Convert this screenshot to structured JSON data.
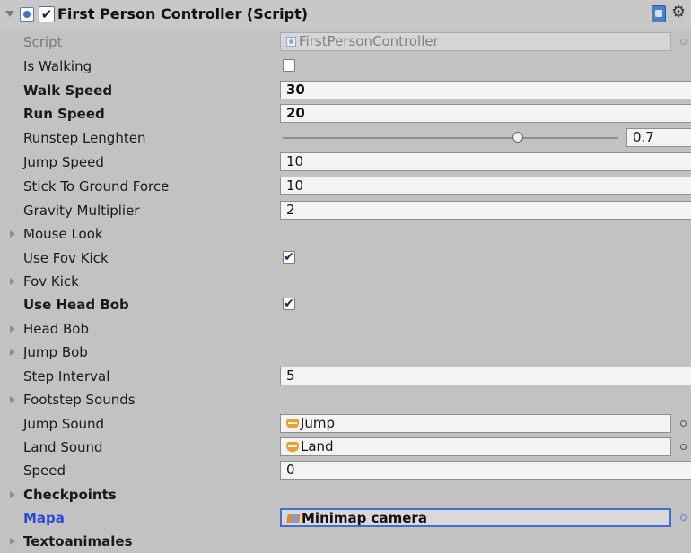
{
  "component": {
    "title": "First Person Controller (Script)",
    "enabled": true,
    "icons": [
      "script-icon",
      "help-book-icon",
      "gear-icon"
    ]
  },
  "rows": {
    "script": {
      "label": "Script",
      "value": "FirstPersonController"
    },
    "is_walking": {
      "label": "Is Walking",
      "checked": false
    },
    "walk_speed": {
      "label": "Walk Speed",
      "value": "30"
    },
    "run_speed": {
      "label": "Run Speed",
      "value": "20"
    },
    "runstep": {
      "label": "Runstep Lenghten",
      "value": "0.7",
      "slider_fraction": 0.7
    },
    "jump_speed": {
      "label": "Jump Speed",
      "value": "10"
    },
    "stick_force": {
      "label": "Stick To Ground Force",
      "value": "10"
    },
    "gravity": {
      "label": "Gravity Multiplier",
      "value": "2"
    },
    "mouse_look": {
      "label": "Mouse Look"
    },
    "use_fov_kick": {
      "label": "Use Fov Kick",
      "checked": true,
      "mark": "✔"
    },
    "fov_kick": {
      "label": "Fov Kick"
    },
    "use_head_bob": {
      "label": "Use Head Bob",
      "checked": true,
      "mark": "✔"
    },
    "head_bob": {
      "label": "Head Bob"
    },
    "jump_bob": {
      "label": "Jump Bob"
    },
    "step_interval": {
      "label": "Step Interval",
      "value": "5"
    },
    "footstep_sounds": {
      "label": "Footstep Sounds"
    },
    "jump_sound": {
      "label": "Jump Sound",
      "value": "Jump"
    },
    "land_sound": {
      "label": "Land Sound",
      "value": "Land"
    },
    "speed": {
      "label": "Speed",
      "value": "0"
    },
    "checkpoints": {
      "label": "Checkpoints"
    },
    "mapa": {
      "label": "Mapa",
      "value": "Minimap camera"
    },
    "textoanimales": {
      "label": "Textoanimales"
    }
  },
  "colors": {
    "panel_bg": "#c2c2c2",
    "field_bg": "#f4f4f4",
    "focus_blue": "#3f6fd6",
    "label_blue": "#2a48d8"
  }
}
